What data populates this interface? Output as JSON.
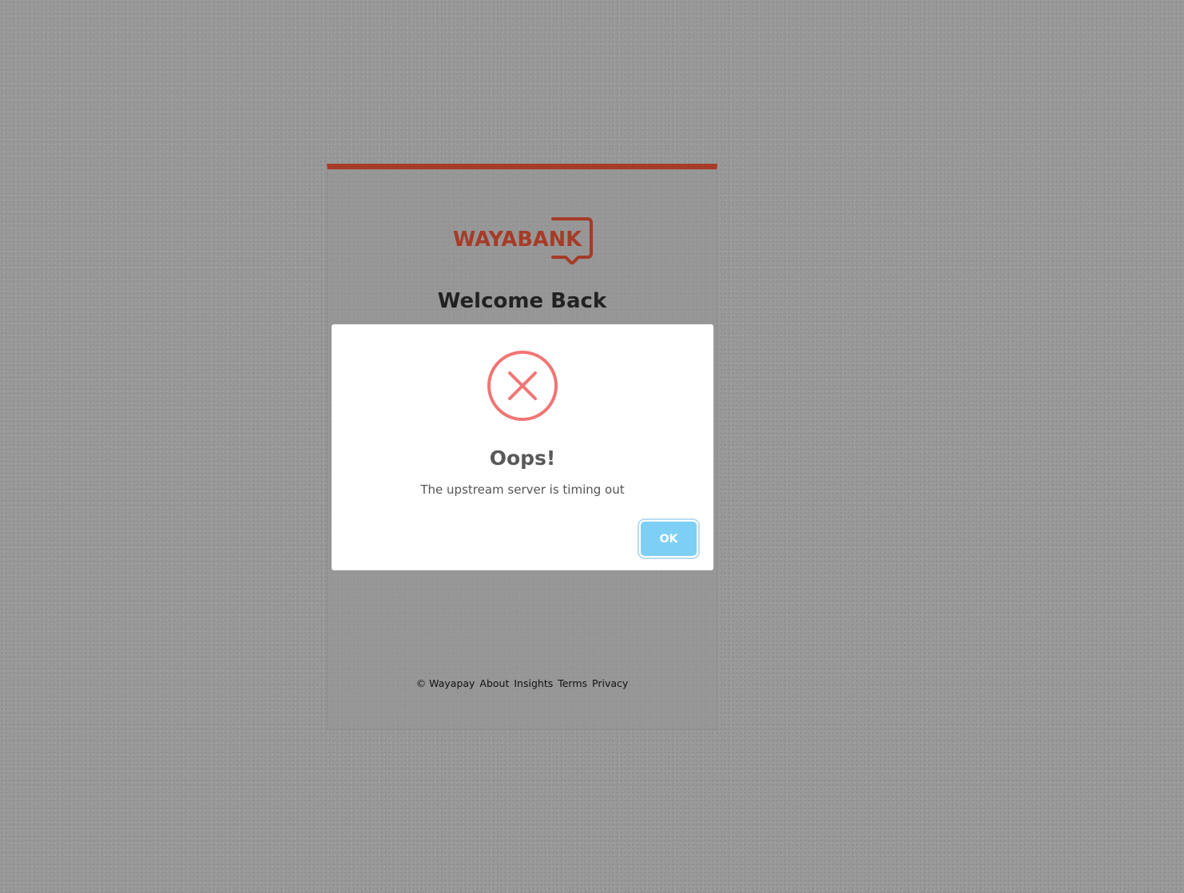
{
  "brand": {
    "logo_text": "WAYABANK",
    "accent_color": "#a63b27"
  },
  "login": {
    "title": "Welcome Back"
  },
  "footer": {
    "copyright": "© Wayapay",
    "links": [
      "About",
      "Insights",
      "Terms",
      "Privacy"
    ]
  },
  "alert": {
    "icon": "error-x-circle-icon",
    "icon_color": "#f27474",
    "title": "Oops!",
    "message": "The upstream server is timing out",
    "ok_label": "OK",
    "ok_color": "#7ecff4"
  }
}
